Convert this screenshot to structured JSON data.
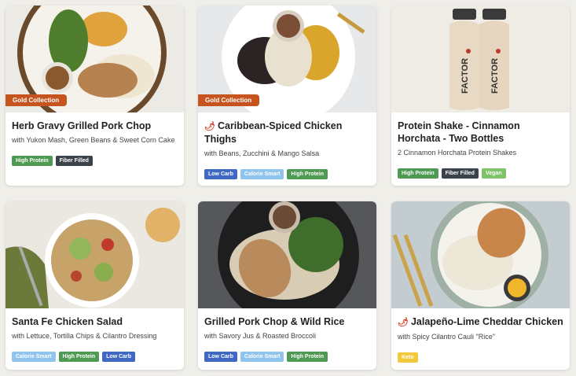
{
  "colors": {
    "high_protein": "#4f9a52",
    "fiber_filled": "#3b424a",
    "low_carb": "#3f68c4",
    "calorie_smart": "#8fc4ef",
    "vegan": "#7ec36a",
    "keto": "#f1c93a",
    "gold_collection": "#c5541f"
  },
  "cards": [
    {
      "title": "Herb Gravy Grilled Pork Chop",
      "subtitle": "with Yukon Mash, Green Beans & Sweet Corn Cake",
      "badge": "Gold Collection",
      "spicy": false,
      "tags": [
        "High Protein",
        "Fiber Filled"
      ]
    },
    {
      "title": "Caribbean-Spiced Chicken Thighs",
      "subtitle": "with Beans, Zucchini & Mango Salsa",
      "badge": "Gold Collection",
      "spicy": true,
      "tags": [
        "Low Carb",
        "Calorie Smart",
        "High Protein"
      ]
    },
    {
      "title": "Protein Shake - Cinnamon Horchata - Two Bottles",
      "subtitle": "2 Cinnamon Horchata Protein Shakes",
      "bottle_label": "FACTOR",
      "tags": [
        "High Protein",
        "Fiber Filled",
        "Vegan"
      ]
    },
    {
      "title": "Santa Fe Chicken Salad",
      "subtitle": "with Lettuce, Tortilla Chips & Cilantro Dressing",
      "tags": [
        "Calorie Smart",
        "High Protein",
        "Low Carb"
      ]
    },
    {
      "title": "Grilled Pork Chop & Wild Rice",
      "subtitle": "with Savory Jus & Roasted Broccoli",
      "tags": [
        "Low Carb",
        "Calorie Smart",
        "High Protein"
      ]
    },
    {
      "title": "Jalapeño-Lime Cheddar Chicken",
      "subtitle": "with Spicy Cilantro Cauli \"Rice\"",
      "spicy": true,
      "tags": [
        "Keto"
      ]
    }
  ]
}
